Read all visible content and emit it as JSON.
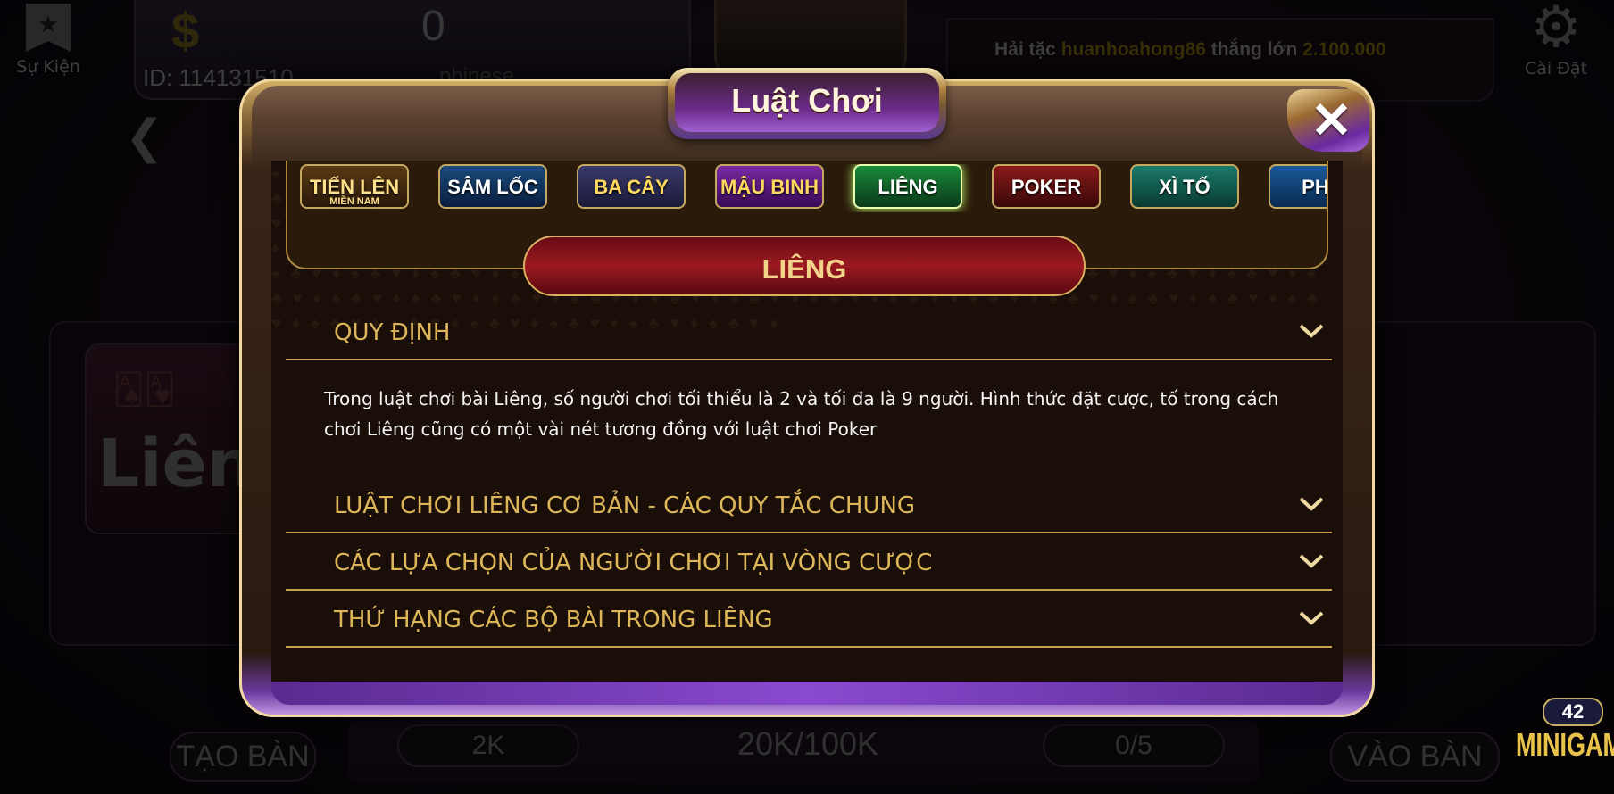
{
  "lobby": {
    "event_label": "Sự Kiện",
    "balance": "0",
    "user_id": "ID: 114131510",
    "username": "phinese",
    "news": {
      "prefix": "Hải tặc",
      "player": "huanhoahong86",
      "middle": "thắng lớn",
      "amount": "2.100.000"
    },
    "settings_label": "Cài Đặt",
    "game_thumb_text": "Liên",
    "bottom": {
      "create_table": "TẠO BÀN",
      "bet_level": "2K",
      "bet_range": "20K/100K",
      "players": "0/5",
      "join_table": "VÀO BÀN",
      "minigame_count": "42",
      "minigame_label": "MINIGAM"
    }
  },
  "modal": {
    "title": "Luật Chơi",
    "close_label": "✕",
    "tabs": [
      {
        "label": "TIẾN LÊN",
        "sub": "MIỀN NAM"
      },
      {
        "label": "SÂM LỐC",
        "sub": ""
      },
      {
        "label": "BA CÂY",
        "sub": ""
      },
      {
        "label": "MẬU BINH",
        "sub": ""
      },
      {
        "label": "LIÊNG",
        "sub": ""
      },
      {
        "label": "POKER",
        "sub": ""
      },
      {
        "label": "XÌ TỐ",
        "sub": ""
      },
      {
        "label": "PHỎ",
        "sub": ""
      }
    ],
    "selected_game": "LIÊNG",
    "sections": [
      {
        "title": "QUY ĐỊNH",
        "expanded": true,
        "content": "Trong luật chơi bài Liêng, số người chơi tối thiểu là 2 và tối đa là 9 người. Hình thức đặt cược, tố trong cách chơi Liêng cũng có một vài nét tương đồng với luật chơi Poker"
      },
      {
        "title": "LUẬT CHƠI LIÊNG CƠ BẢN - CÁC QUY TẮC CHUNG",
        "expanded": false
      },
      {
        "title": "CÁC LỰA CHỌN CỦA NGƯỜI CHƠI TẠI VÒNG CƯỢC",
        "expanded": false
      },
      {
        "title": "THỨ HẠNG CÁC BỘ BÀI TRONG LIÊNG",
        "expanded": false
      }
    ]
  },
  "colors": {
    "gold": "#ddb65a",
    "banner_red": "#9a1a20",
    "purple": "#6a2aa0"
  }
}
